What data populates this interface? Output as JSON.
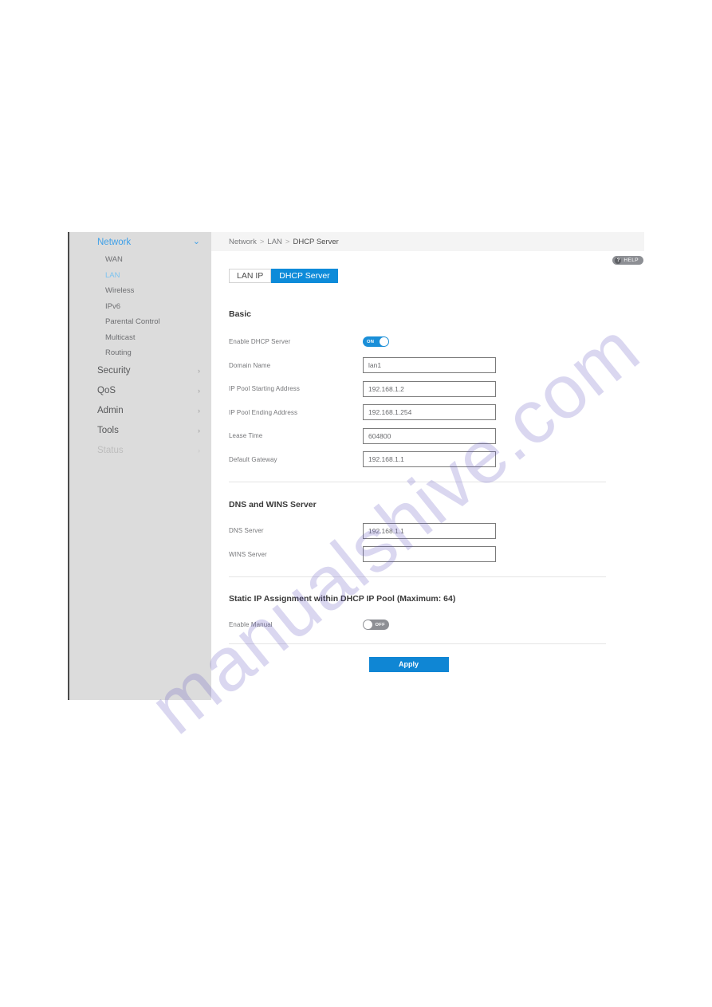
{
  "watermark": {
    "text": "manualshive.com"
  },
  "breadcrumb": {
    "items": [
      "Network",
      "LAN",
      "DHCP Server"
    ],
    "separator": ">"
  },
  "help": {
    "label": "HELP",
    "icon": "question-mark-icon",
    "glyph": "?"
  },
  "sidebar": {
    "groups": [
      {
        "label": "Network",
        "state": "active",
        "caret": "chevron-down-icon",
        "caret_glyph": "⌄",
        "children": [
          {
            "label": "WAN",
            "state": "normal"
          },
          {
            "label": "LAN",
            "state": "active"
          },
          {
            "label": "Wireless",
            "state": "normal"
          },
          {
            "label": "IPv6",
            "state": "normal"
          },
          {
            "label": "Parental Control",
            "state": "normal"
          },
          {
            "label": "Multicast",
            "state": "normal"
          },
          {
            "label": "Routing",
            "state": "normal"
          }
        ]
      },
      {
        "label": "Security",
        "state": "normal",
        "caret": "chevron-right-icon",
        "caret_glyph": "›",
        "children": []
      },
      {
        "label": "QoS",
        "state": "normal",
        "caret": "chevron-right-icon",
        "caret_glyph": "›",
        "children": []
      },
      {
        "label": "Admin",
        "state": "normal",
        "caret": "chevron-right-icon",
        "caret_glyph": "›",
        "children": []
      },
      {
        "label": "Tools",
        "state": "normal",
        "caret": "chevron-right-icon",
        "caret_glyph": "›",
        "children": []
      },
      {
        "label": "Status",
        "state": "faded",
        "caret": "chevron-right-icon",
        "caret_glyph": "›",
        "children": []
      }
    ]
  },
  "tabs": [
    {
      "label": "LAN IP",
      "active": false
    },
    {
      "label": "DHCP Server",
      "active": true
    }
  ],
  "sections": {
    "basic": {
      "title": "Basic",
      "fields": [
        {
          "label": "Enable DHCP Server",
          "type": "toggle",
          "value": "ON",
          "on": true
        },
        {
          "label": "Domain Name",
          "type": "text",
          "value": "lan1",
          "placeholder": ""
        },
        {
          "label": "IP Pool Starting Address",
          "type": "text",
          "value": "192.168.1.2",
          "placeholder": ""
        },
        {
          "label": "IP Pool Ending Address",
          "type": "text",
          "value": "192.168.1.254",
          "placeholder": ""
        },
        {
          "label": "Lease Time",
          "type": "text",
          "value": "604800",
          "placeholder": ""
        },
        {
          "label": "Default Gateway",
          "type": "text",
          "value": "192.168.1.1",
          "placeholder": ""
        }
      ]
    },
    "dns_wins": {
      "title": "DNS and WINS Server",
      "fields": [
        {
          "label": "DNS Server",
          "type": "text",
          "value": "192.168.1.1",
          "placeholder": ""
        },
        {
          "label": "WINS Server",
          "type": "text",
          "value": "",
          "placeholder": ""
        }
      ]
    },
    "static_ip": {
      "title": "Static IP Assignment within DHCP IP Pool (Maximum: 64)",
      "fields": [
        {
          "label": "Enable Manual",
          "type": "toggle",
          "value": "OFF",
          "on": false
        }
      ]
    }
  },
  "apply": {
    "label": "Apply"
  },
  "colors": {
    "accent_blue": "#0d8bd9",
    "apply_blue": "#0f86d4",
    "toggle_on": "#1a8fd8",
    "toggle_off": "#8d8f94",
    "sidebar_bg": "#dcdcdc",
    "breadcrumb_bg": "#f4f4f4",
    "active_link": "#3fa0e8"
  }
}
